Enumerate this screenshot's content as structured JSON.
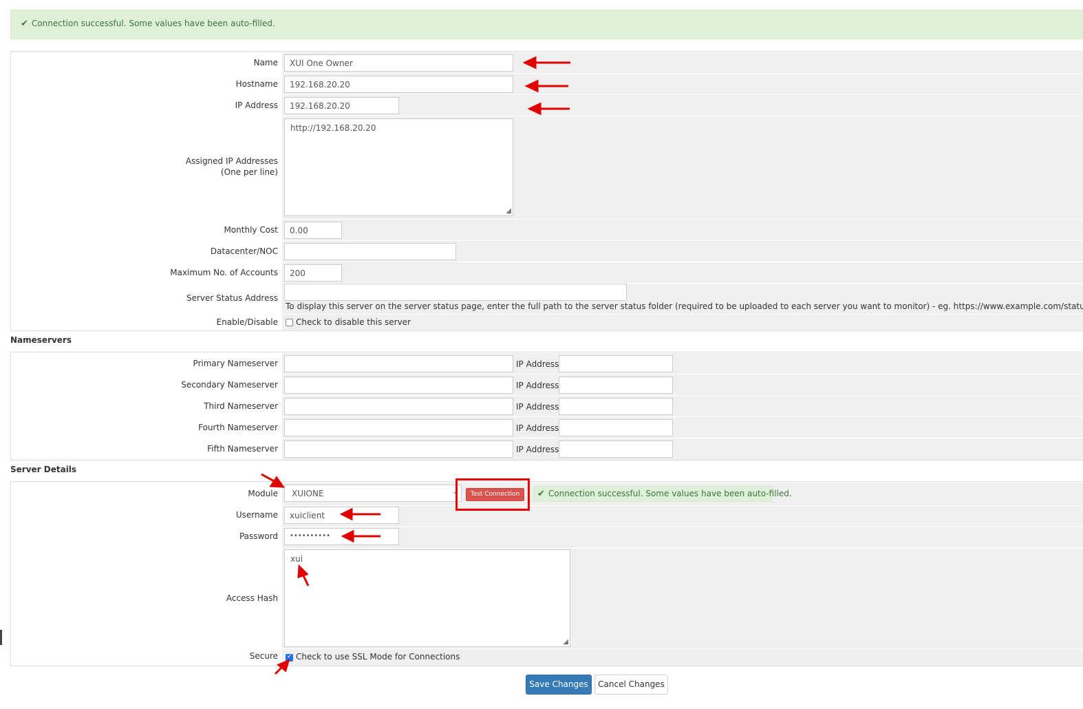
{
  "top_alert": "Connection successful. Some values have been auto-filled.",
  "server": {
    "name_label": "Name",
    "name_value": "XUI One Owner",
    "hostname_label": "Hostname",
    "hostname_value": "192.168.20.20",
    "ip_label": "IP Address",
    "ip_value": "192.168.20.20",
    "assigned_ip_label_1": "Assigned IP Addresses",
    "assigned_ip_label_2": "(One per line)",
    "assigned_ip_value": "http://192.168.20.20",
    "monthly_cost_label": "Monthly Cost",
    "monthly_cost_value": "0.00",
    "datacenter_label": "Datacenter/NOC",
    "datacenter_value": "",
    "max_accounts_label": "Maximum No. of Accounts",
    "max_accounts_value": "200",
    "status_address_label": "Server Status Address",
    "status_address_value": "",
    "status_address_help": "To display this server on the server status page, enter the full path to the server status folder (required to be uploaded to each server you want to monitor) - eg. https://www.example.com/status/",
    "enable_label": "Enable/Disable",
    "enable_checkbox_text": "Check to disable this server"
  },
  "nameservers": {
    "heading": "Nameservers",
    "ip_label": "IP Address:",
    "rows": [
      {
        "label": "Primary Nameserver"
      },
      {
        "label": "Secondary Nameserver"
      },
      {
        "label": "Third Nameserver"
      },
      {
        "label": "Fourth Nameserver"
      },
      {
        "label": "Fifth Nameserver"
      }
    ]
  },
  "details": {
    "heading": "Server Details",
    "module_label": "Module",
    "module_value": "XUIONE",
    "test_button": "Test Connection",
    "test_result": "Connection successful. Some values have been auto-filled.",
    "username_label": "Username",
    "username_value": "xuiclient",
    "password_label": "Password",
    "password_value": "••••••••••",
    "access_hash_label": "Access Hash",
    "access_hash_value": "xui",
    "secure_label": "Secure",
    "secure_checkbox_text": "Check to use SSL Mode for Connections",
    "secure_checked": true
  },
  "actions": {
    "save": "Save Changes",
    "cancel": "Cancel Changes"
  },
  "colors": {
    "annotation_red": "#e00000",
    "primary_blue": "#337ab7",
    "danger_red": "#d9534f",
    "success_bg": "#dff0d8"
  }
}
